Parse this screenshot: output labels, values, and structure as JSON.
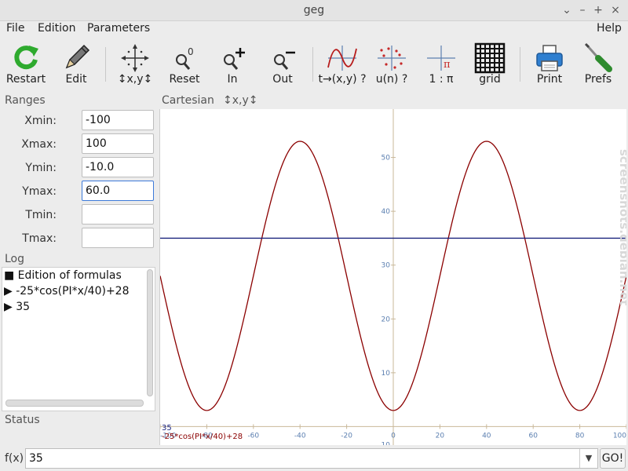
{
  "window": {
    "title": "geg",
    "buttons": [
      "⌄",
      "–",
      "+",
      "×"
    ]
  },
  "menu": [
    "File",
    "Edition",
    "Parameters",
    "Help"
  ],
  "toolbar": {
    "restart": "Restart",
    "edit": "Edit",
    "move": "↕x,y↕",
    "reset": "Reset",
    "zoom_in": "In",
    "zoom_out": "Out",
    "parametric": "t→(x,y) ?",
    "sequence": "u(n) ?",
    "pi_scale": "1 : π",
    "grid": "grid",
    "print": "Print",
    "prefs": "Prefs"
  },
  "ranges": {
    "header": "Ranges",
    "rows": [
      {
        "label": "Xmin:",
        "value": "-100"
      },
      {
        "label": "Xmax:",
        "value": "100"
      },
      {
        "label": "Ymin:",
        "value": "-10.0"
      },
      {
        "label": "Ymax:",
        "value": "60.0"
      },
      {
        "label": "Tmin:",
        "value": ""
      },
      {
        "label": "Tmax:",
        "value": ""
      }
    ]
  },
  "log": {
    "header": "Log",
    "items": [
      "■ Edition of formulas",
      "▶ -25*cos(PI*x/40)+28",
      "▶ 35"
    ]
  },
  "status": {
    "header": "Status"
  },
  "graph": {
    "header_mode": "Cartesian",
    "header_move": "↕x,y↕",
    "legend": [
      {
        "text": "35",
        "color": "#1a237e"
      },
      {
        "text": "-25*cos(PI*x/40)+28",
        "color": "#8b0000"
      }
    ]
  },
  "fx": {
    "label": "f(x)",
    "value": "35",
    "go": "GO!"
  },
  "watermark": "screenshots.debian.net",
  "chart_data": {
    "type": "line",
    "xlim": [
      -100,
      100
    ],
    "ylim": [
      -10,
      60
    ],
    "xticks": [
      -100,
      -80,
      -60,
      -40,
      -20,
      0,
      20,
      40,
      60,
      80,
      100
    ],
    "xtick_labels": [
      "-100",
      "-80",
      "-60",
      "-40",
      "-20",
      "0",
      "20",
      "40",
      "60",
      "80",
      "100"
    ],
    "yticks": [
      10,
      20,
      30,
      40,
      50
    ],
    "ytick_labels": [
      "10",
      "20",
      "30",
      "40",
      "50"
    ],
    "grid": false,
    "series": [
      {
        "name": "-25*cos(PI*x/40)+28",
        "color": "#8b0000",
        "x": [
          -100,
          -95,
          -90,
          -85,
          -80,
          -75,
          -70,
          -65,
          -60,
          -55,
          -50,
          -45,
          -40,
          -35,
          -30,
          -25,
          -20,
          -15,
          -10,
          -5,
          0,
          5,
          10,
          15,
          20,
          25,
          30,
          35,
          40,
          45,
          50,
          55,
          60,
          65,
          70,
          75,
          80,
          85,
          90,
          95,
          100
        ],
        "y": [
          28,
          18.4,
          10.3,
          4.9,
          3,
          4.9,
          10.3,
          18.4,
          28,
          37.6,
          45.7,
          51.1,
          53,
          51.1,
          45.7,
          37.6,
          28,
          18.4,
          10.3,
          4.9,
          3,
          4.9,
          10.3,
          18.4,
          28,
          37.6,
          45.7,
          51.1,
          53,
          51.1,
          45.7,
          37.6,
          28,
          18.4,
          10.3,
          4.9,
          3,
          4.9,
          10.3,
          18.4,
          28
        ]
      },
      {
        "name": "35",
        "color": "#1a237e",
        "x": [
          -100,
          100
        ],
        "y": [
          35,
          35
        ]
      }
    ]
  }
}
